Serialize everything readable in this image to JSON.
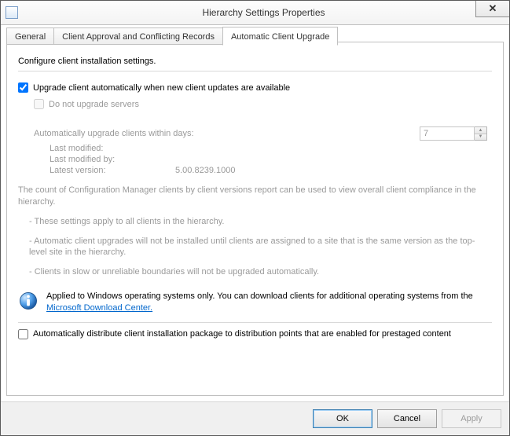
{
  "window": {
    "title": "Hierarchy Settings Properties"
  },
  "tabs": {
    "general": "General",
    "approval": "Client Approval and Conflicting Records",
    "upgrade": "Automatic Client Upgrade"
  },
  "content": {
    "intro": "Configure client installation settings.",
    "upgrade_cb_label": "Upgrade client automatically when new client updates are available",
    "dont_upgrade_servers_label": "Do not upgrade servers",
    "days_label": "Automatically upgrade clients within days:",
    "days_value": "7",
    "last_modified_label": "Last modified:",
    "last_modified_value": "",
    "last_modified_by_label": "Last modified by:",
    "last_modified_by_value": "",
    "latest_version_label": "Latest version:",
    "latest_version_value": "5.00.8239.1000",
    "compliance_note": "The count of Configuration Manager clients by client versions report can be used to view overall client compliance in the hierarchy.",
    "bullet1": "- These settings apply to all clients in the hierarchy.",
    "bullet2": "- Automatic client upgrades will not be installed until clients are assigned to a site that is the same version as the top-level site in the hierarchy.",
    "bullet3": "- Clients in slow or unreliable boundaries will not be upgraded automatically.",
    "info_text_pre": "Applied to Windows operating systems only. You can download clients for additional operating systems from the ",
    "info_link": "Microsoft Download Center.",
    "prestaged_label": "Automatically distribute client installation package to distribution points that are enabled for prestaged content"
  },
  "buttons": {
    "ok": "OK",
    "cancel": "Cancel",
    "apply": "Apply"
  }
}
